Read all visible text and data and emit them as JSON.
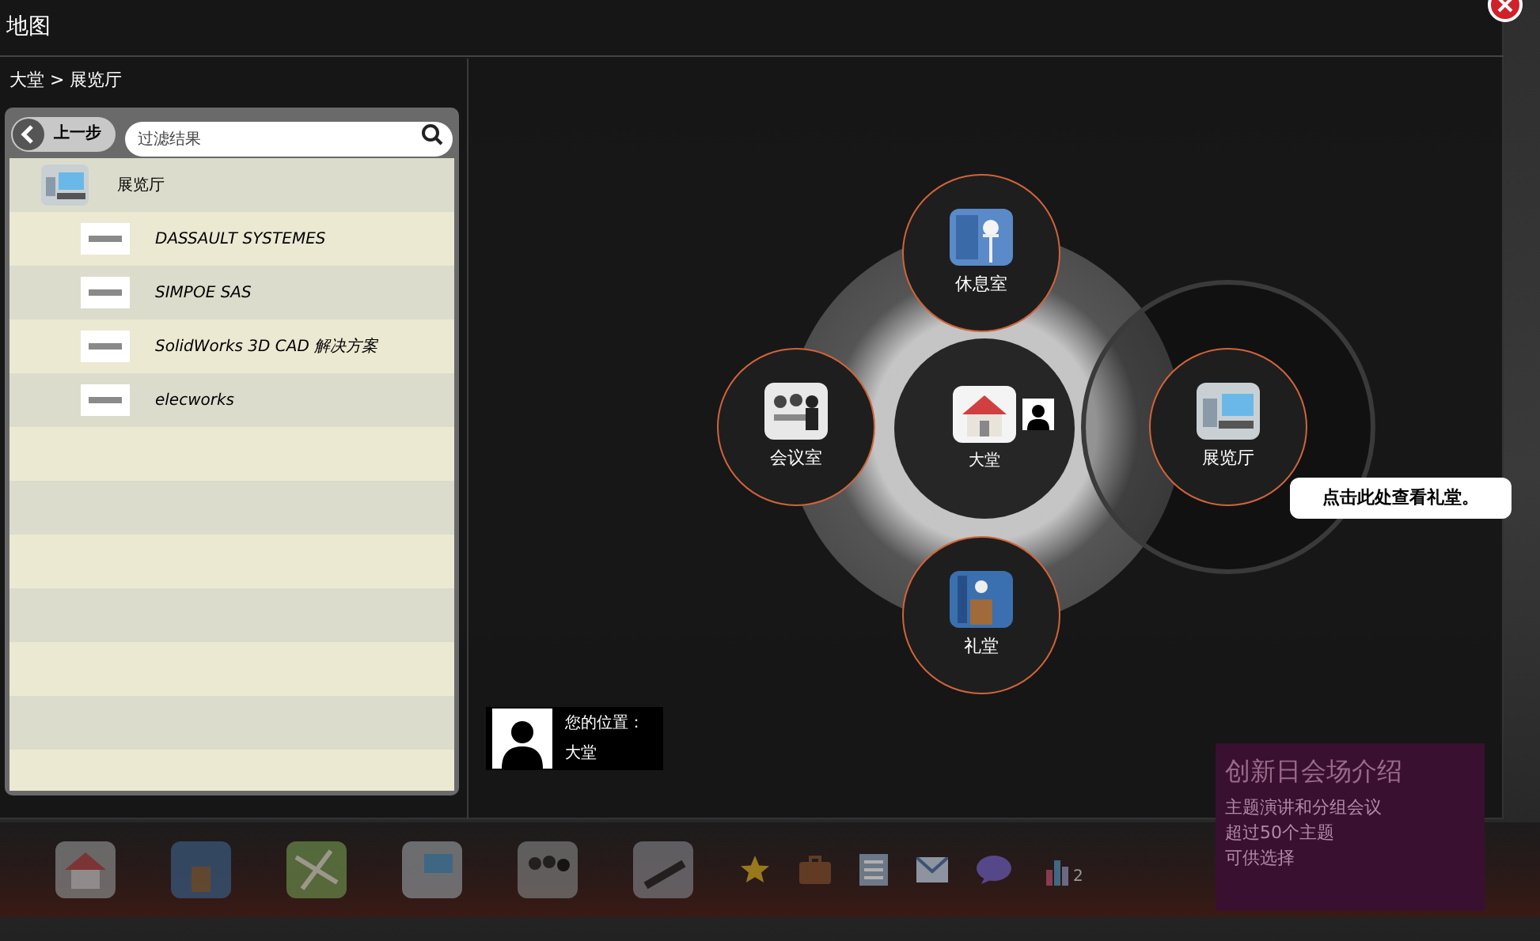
{
  "window": {
    "title": "地图"
  },
  "breadcrumb": "大堂 > 展览厅",
  "back_button": "上一步",
  "filter": {
    "placeholder": "过滤结果"
  },
  "list": [
    {
      "label": "展览厅",
      "kind": "hall",
      "children": [
        {
          "label": "DASSAULT SYSTEMES"
        },
        {
          "label": "SIMPOE SAS"
        },
        {
          "label": "SolidWorks 3D CAD 解决方案"
        },
        {
          "label": "elecworks"
        }
      ]
    }
  ],
  "map": {
    "nodes": [
      {
        "label": "休息室",
        "kind": "lounge",
        "current": false,
        "highlighted": false
      },
      {
        "label": "会议室",
        "kind": "meeting",
        "current": false,
        "highlighted": false
      },
      {
        "label": "大堂",
        "kind": "lobby",
        "current": true,
        "highlighted": false
      },
      {
        "label": "展览厅",
        "kind": "hall",
        "current": false,
        "highlighted": true
      },
      {
        "label": "礼堂",
        "kind": "auditorium",
        "current": false,
        "highlighted": false
      }
    ],
    "tooltip": "点击此处查看礼堂。"
  },
  "location": {
    "label": "您的位置：",
    "value": "大堂"
  },
  "banner": {
    "title": "创新日会场介绍",
    "lines": [
      "主题演讲和分组会议",
      "超过50个主题",
      "可供选择"
    ]
  },
  "dock": {
    "badge": "2"
  }
}
